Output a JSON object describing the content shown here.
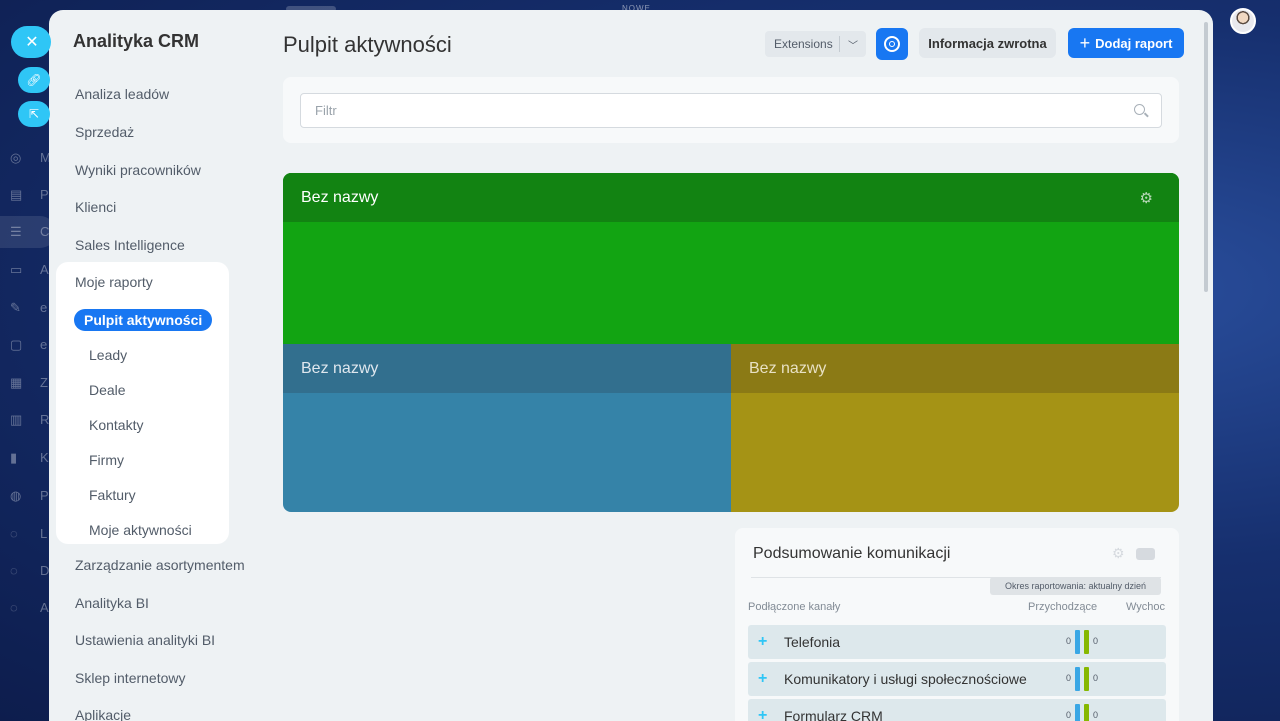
{
  "background": {
    "top_note": "NOWE",
    "rail_letters": [
      "M",
      "P",
      "C",
      "A",
      "e",
      "e",
      "Z",
      "R",
      "K",
      "P",
      "L",
      "D",
      "A"
    ]
  },
  "menu": {
    "title": "Analityka CRM",
    "items_top": [
      "Analiza leadów",
      "Sprzedaż",
      "Wyniki pracowników",
      "Klienci",
      "Sales Intelligence"
    ],
    "group": {
      "label": "Moje raporty",
      "active": "Pulpit aktywności",
      "children": [
        "Leady",
        "Deale",
        "Kontakty",
        "Firmy",
        "Faktury",
        "Moje aktywności"
      ]
    },
    "items_bottom": [
      "Zarządzanie asortymentem",
      "Analityka BI",
      "Ustawienia analityki BI",
      "Sklep internetowy",
      "Aplikacje"
    ]
  },
  "header": {
    "title": "Pulpit aktywności",
    "extensions_label": "Extensions",
    "feedback_label": "Informacja zwrotna",
    "add_report_label": "Dodaj raport"
  },
  "filter": {
    "placeholder": "Filtr"
  },
  "widgets": {
    "green_title": "Bez nazwy",
    "blue_title": "Bez nazwy",
    "yellow_title": "Bez nazwy",
    "colors": {
      "green": "#12a412",
      "blue": "#3583a8",
      "yellow": "#a59315"
    }
  },
  "communication": {
    "title": "Podsumowanie komunikacji",
    "period": "Okres raportowania: aktualny dzień",
    "col_channels": "Podłączone kanały",
    "col_incoming": "Przychodzące",
    "col_outgoing": "Wychoc",
    "rows": [
      {
        "name": "Telefonia",
        "incoming": "0",
        "outgoing": "0"
      },
      {
        "name": "Komunikatory i usługi społecznościowe",
        "incoming": "0",
        "outgoing": "0"
      },
      {
        "name": "Formularz CRM",
        "incoming": "0",
        "outgoing": "0"
      }
    ]
  },
  "colors": {
    "accent": "#1877f2",
    "close": "#2fc6f6"
  }
}
